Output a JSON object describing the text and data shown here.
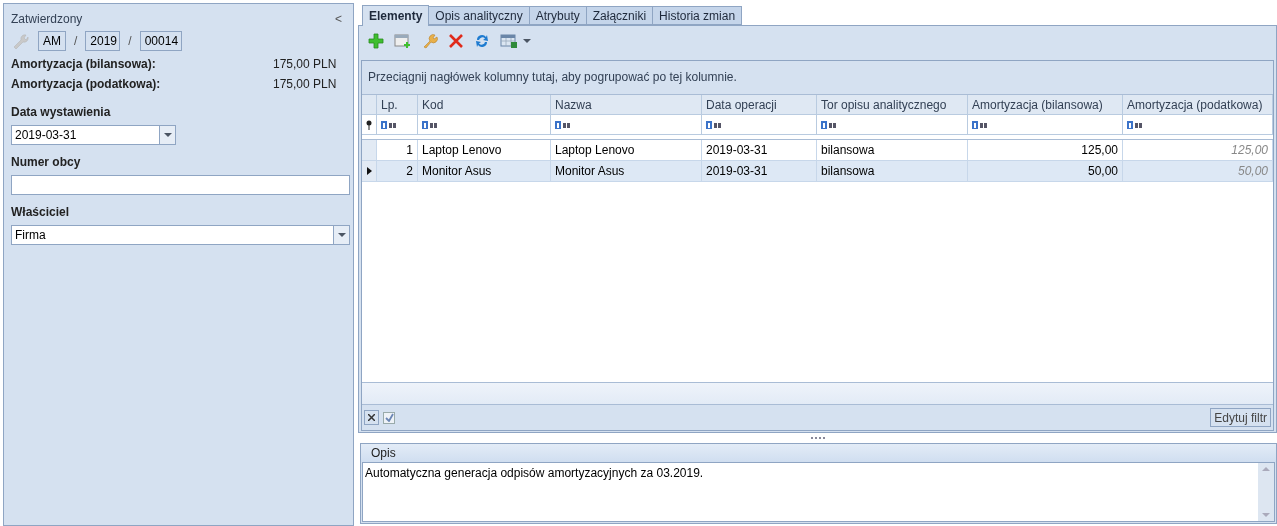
{
  "header": {
    "status": "Zatwierdzony",
    "collapse": "<",
    "number": {
      "prefix": "AM",
      "sep1": "/",
      "year": "2019",
      "sep2": "/",
      "seq": "00014"
    }
  },
  "totals": [
    {
      "label": "Amortyzacja (bilansowa):",
      "value": "175,00 PLN"
    },
    {
      "label": "Amortyzacja (podatkowa):",
      "value": "175,00 PLN"
    }
  ],
  "fields": [
    {
      "label": "Data wystawienia",
      "kind": "date",
      "value": "2019-03-31"
    },
    {
      "label": "Numer obcy",
      "kind": "text"
    },
    {
      "label": "Właściciel",
      "kind": "dropdown",
      "value": "Firma"
    }
  ],
  "tabs": [
    {
      "label": "Elementy",
      "selected": true
    },
    {
      "label": "Opis analityczny",
      "selected": false
    },
    {
      "label": "Atrybuty",
      "selected": false
    },
    {
      "label": "Załączniki",
      "selected": false
    },
    {
      "label": "Historia zmian",
      "selected": false
    }
  ],
  "grid": {
    "group_hint": "Przeciągnij nagłówek kolumny tutaj, aby pogrupować po tej kolumnie.",
    "columns": [
      {
        "label": "Lp.",
        "kind": "number"
      },
      {
        "label": "Kod",
        "kind": "text"
      },
      {
        "label": "Nazwa",
        "kind": "text"
      },
      {
        "label": "Data operacji",
        "kind": "text"
      },
      {
        "label": "Tor opisu analitycznego",
        "kind": "text"
      },
      {
        "label": "Amortyzacja (bilansowa)",
        "kind": "number"
      },
      {
        "label": "Amortyzacja (podatkowa)",
        "kind": "computed"
      }
    ],
    "rows": [
      {
        "selected": false,
        "cells": [
          "1",
          "Laptop Lenovo",
          "Laptop Lenovo",
          "2019-03-31",
          "bilansowa",
          "125,00",
          "125,00"
        ]
      },
      {
        "selected": true,
        "cells": [
          "2",
          "Monitor Asus",
          "Monitor Asus",
          "2019-03-31",
          "bilansowa",
          "50,00",
          "50,00"
        ]
      }
    ],
    "filter_enabled": {
      "checked": true
    },
    "edit_filter": "Edytuj filtr"
  },
  "description": {
    "title": "Opis",
    "text": "Automatyczna generacja odpisów amortyzacyjnych za 03.2019."
  }
}
